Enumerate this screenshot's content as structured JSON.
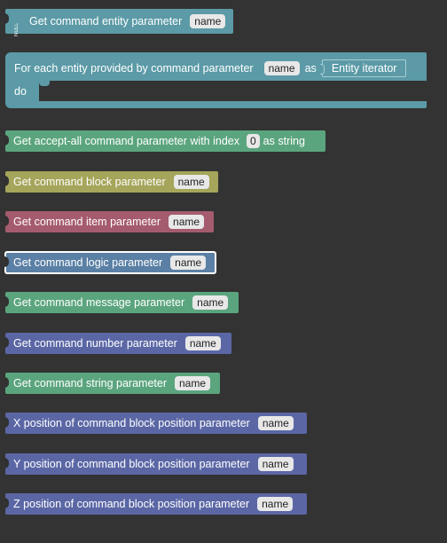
{
  "blocks": {
    "entity_param": {
      "label": "Get command entity parameter",
      "field": "name",
      "badge": "NULL"
    },
    "foreach": {
      "label": "For each entity provided by command parameter",
      "field": "name",
      "as": "as",
      "iterator": "Entity iterator",
      "do": "do"
    },
    "acceptall": {
      "label": "Get accept-all command parameter with index",
      "index": "0",
      "suffix": "as string"
    },
    "block_param": {
      "label": "Get command block parameter",
      "field": "name"
    },
    "item_param": {
      "label": "Get command item parameter",
      "field": "name"
    },
    "logic_param": {
      "label": "Get command logic parameter",
      "field": "name"
    },
    "message_param": {
      "label": "Get command message parameter",
      "field": "name"
    },
    "number_param": {
      "label": "Get command number parameter",
      "field": "name"
    },
    "string_param": {
      "label": "Get command string parameter",
      "field": "name"
    },
    "x_pos": {
      "label": "X position of command block position parameter",
      "field": "name"
    },
    "y_pos": {
      "label": "Y position of command block position parameter",
      "field": "name"
    },
    "z_pos": {
      "label": "Z position of command block position parameter",
      "field": "name"
    }
  },
  "colors": {
    "teal": "#5b9aa6",
    "green": "#5ba57e",
    "olive": "#a5a55b",
    "rose": "#a55b6e",
    "blue": "#5b80a5",
    "indigo": "#5b67a5",
    "background": "#333333"
  }
}
